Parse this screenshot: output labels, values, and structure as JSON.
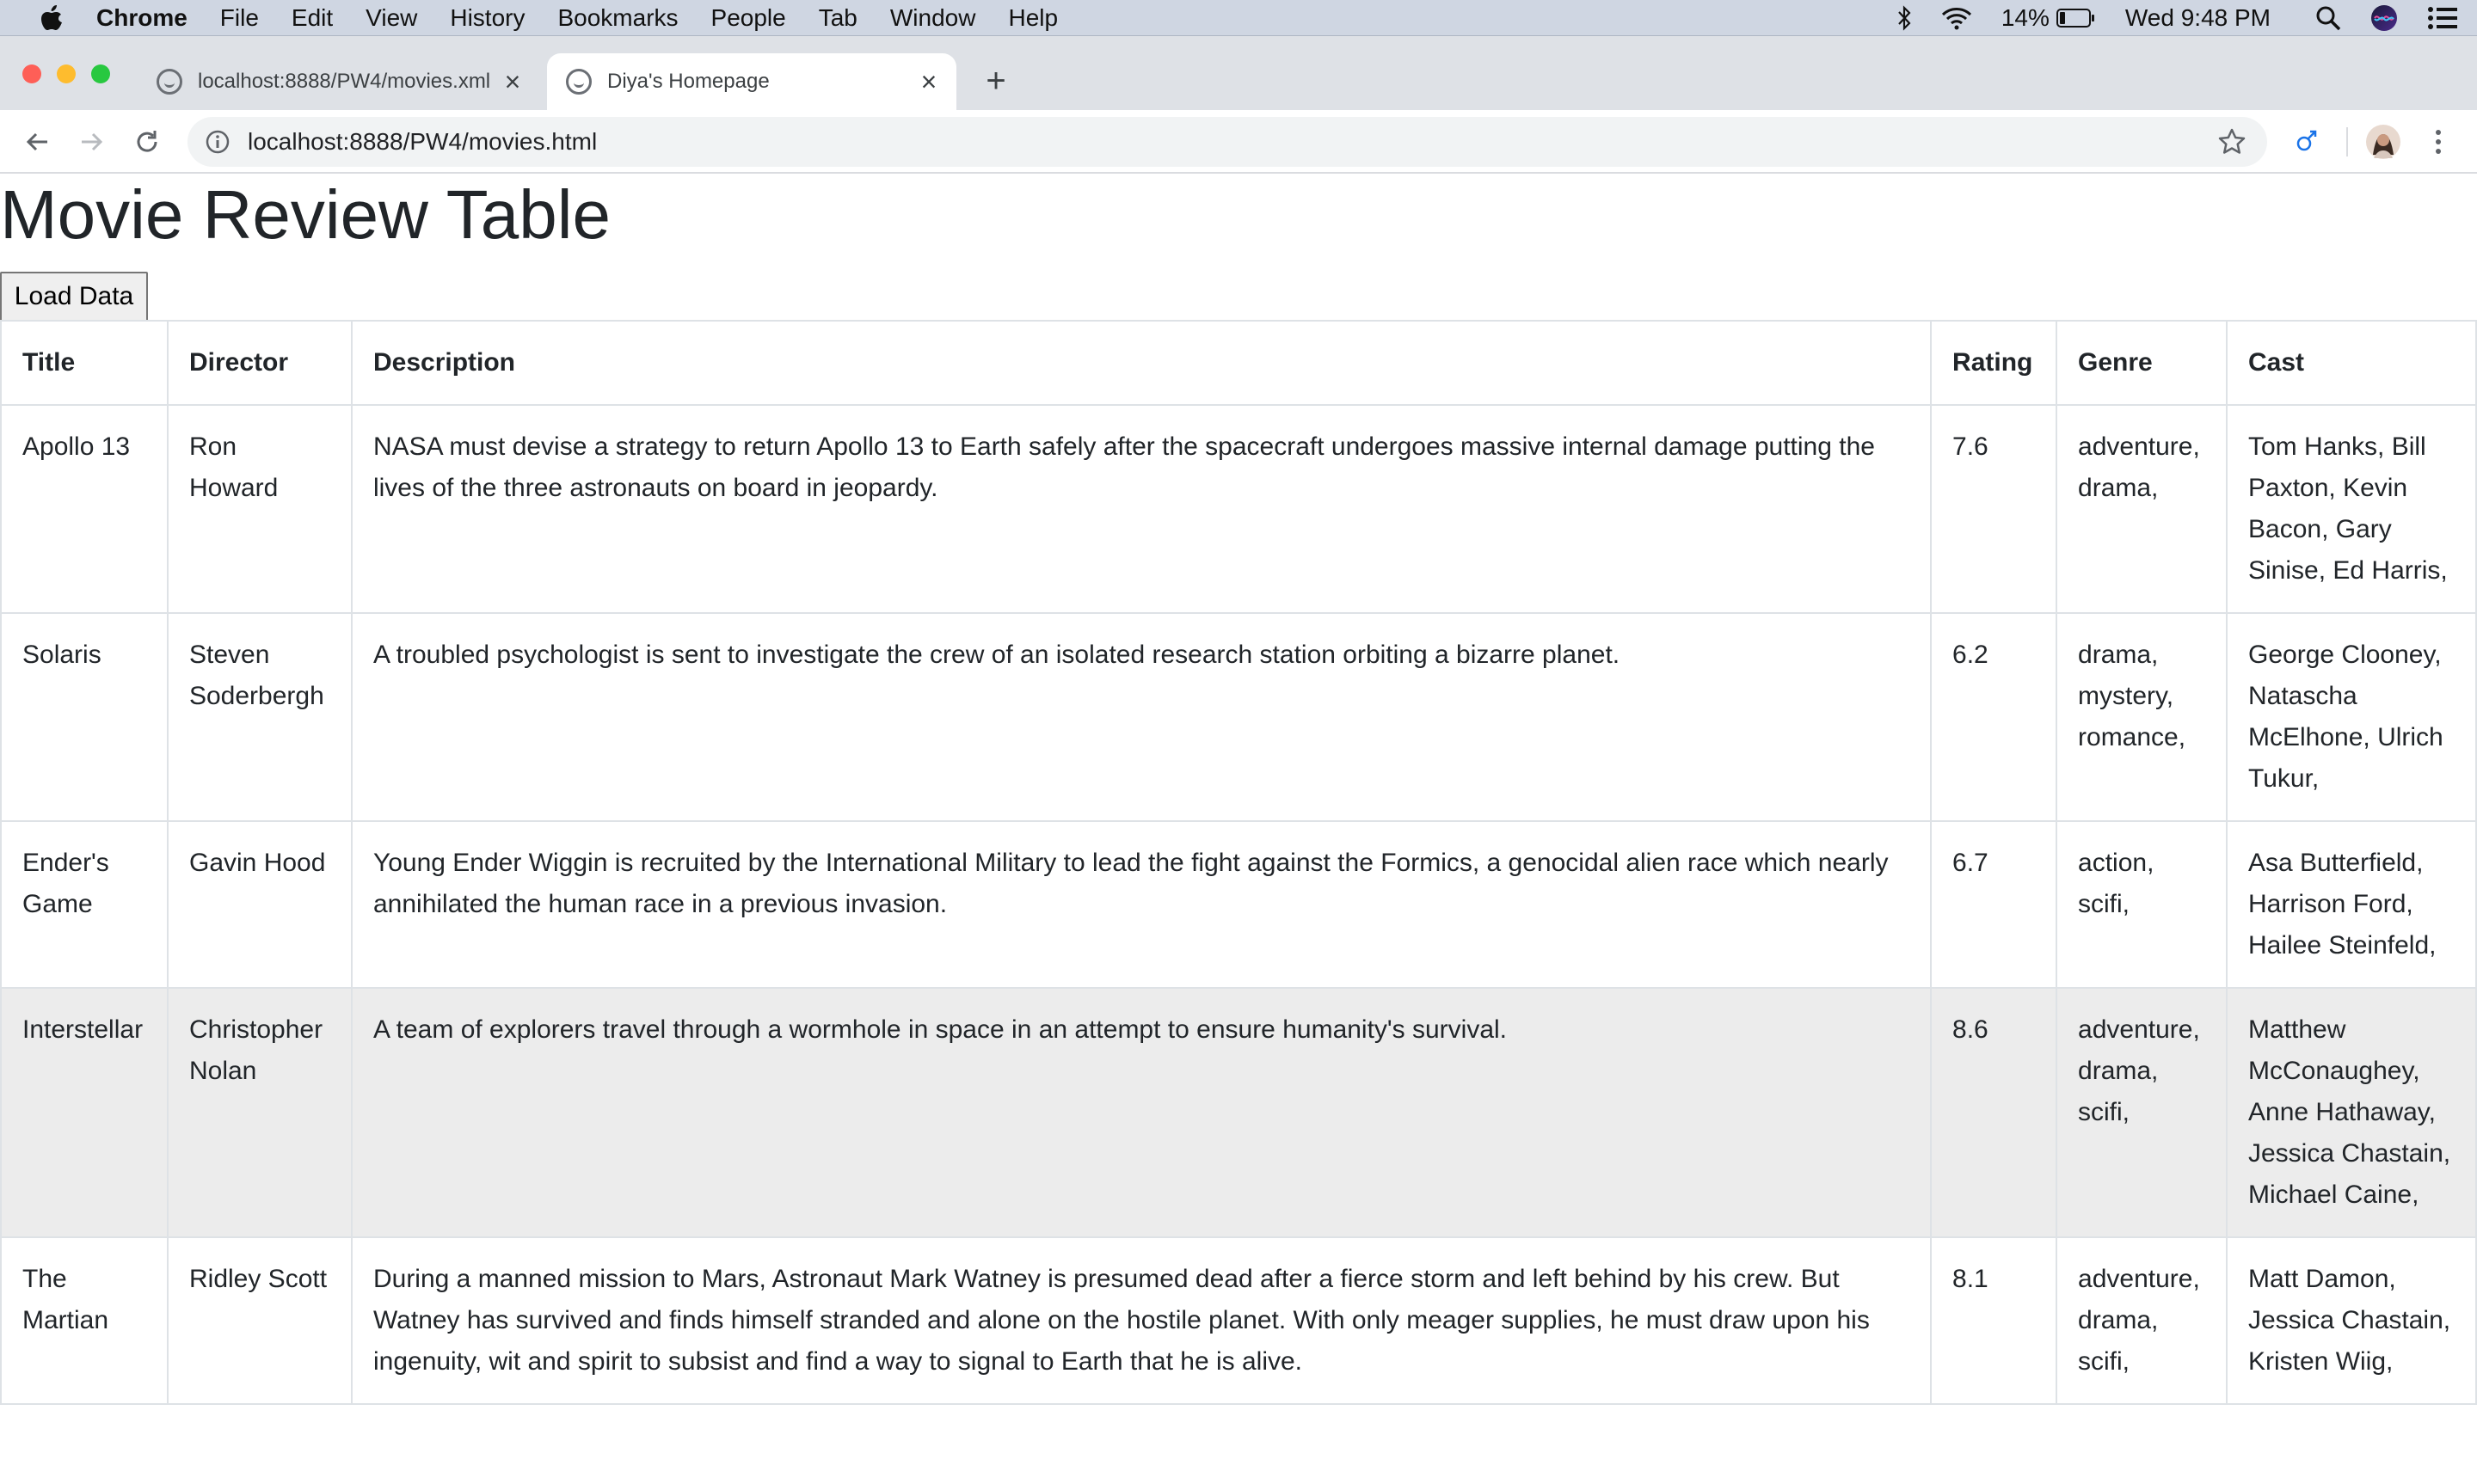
{
  "menubar": {
    "app": "Chrome",
    "items": [
      "File",
      "Edit",
      "View",
      "History",
      "Bookmarks",
      "People",
      "Tab",
      "Window",
      "Help"
    ],
    "battery": "14%",
    "clock": "Wed 9:48 PM"
  },
  "tabs": [
    {
      "title": "localhost:8888/PW4/movies.xml",
      "active": false
    },
    {
      "title": "Diya's Homepage",
      "active": true
    }
  ],
  "toolbar": {
    "url": "localhost:8888/PW4/movies.html"
  },
  "page": {
    "title": "Movie Review Table",
    "load_button": "Load Data",
    "columns": [
      "Title",
      "Director",
      "Description",
      "Rating",
      "Genre",
      "Cast"
    ],
    "rows": [
      {
        "title": "Apollo 13",
        "director": "Ron Howard",
        "description": "NASA must devise a strategy to return Apollo 13 to Earth safely after the spacecraft undergoes massive internal damage putting the lives of the three astronauts on board in jeopardy.",
        "rating": "7.6",
        "genre": "adventure, drama,",
        "cast": "Tom Hanks, Bill Paxton, Kevin Bacon, Gary Sinise, Ed Harris,"
      },
      {
        "title": "Solaris",
        "director": "Steven Soderbergh",
        "description": "A troubled psychologist is sent to investigate the crew of an isolated research station orbiting a bizarre planet.",
        "rating": "6.2",
        "genre": "drama, mystery, romance,",
        "cast": "George Clooney, Natascha McElhone, Ulrich Tukur,"
      },
      {
        "title": "Ender's Game",
        "director": "Gavin Hood",
        "description": "Young Ender Wiggin is recruited by the International Military to lead the fight against the Formics, a genocidal alien race which nearly annihilated the human race in a previous invasion.",
        "rating": "6.7",
        "genre": "action, scifi,",
        "cast": "Asa Butterfield, Harrison Ford, Hailee Steinfeld,"
      },
      {
        "title": "Interstellar",
        "director": "Christopher Nolan",
        "description": "A team of explorers travel through a wormhole in space in an attempt to ensure humanity's survival.",
        "rating": "8.6",
        "genre": "adventure, drama, scifi,",
        "cast": "Matthew McConaughey, Anne Hathaway, Jessica Chastain, Michael Caine,"
      },
      {
        "title": "The Martian",
        "director": "Ridley Scott",
        "description": "During a manned mission to Mars, Astronaut Mark Watney is presumed dead after a fierce storm and left behind by his crew. But Watney has survived and finds himself stranded and alone on the hostile planet. With only meager supplies, he must draw upon his ingenuity, wit and spirit to subsist and find a way to signal to Earth that he is alive.",
        "rating": "8.1",
        "genre": "adventure, drama, scifi,",
        "cast": "Matt Damon, Jessica Chastain, Kristen Wiig,"
      }
    ]
  },
  "colors": {
    "menubar_bg": "#cfd6e2",
    "tabstrip_bg": "#dee1e6",
    "close_red": "#fe5f57",
    "minimize_yellow": "#febc2e",
    "zoom_green": "#28c840",
    "table_border": "#dee2e6",
    "row_hover": "#ececec",
    "extension_blue": "#1a73e8"
  },
  "icons": {
    "menubar": [
      "apple-icon",
      "bluetooth-icon",
      "wifi-icon",
      "battery-icon",
      "search-icon",
      "siri-icon",
      "control-center-icon"
    ],
    "toolbar": [
      "back-icon",
      "forward-icon",
      "reload-icon",
      "info-icon",
      "star-icon",
      "extension-icon",
      "profile-avatar",
      "more-icon"
    ]
  }
}
